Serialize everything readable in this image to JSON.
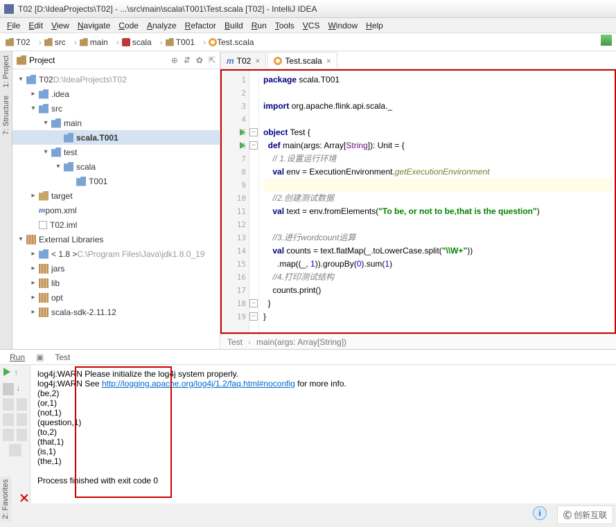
{
  "title": "T02 [D:\\IdeaProjects\\T02] - ...\\src\\main\\scala\\T001\\Test.scala [T02] - IntelliJ IDEA",
  "menu": [
    "File",
    "Edit",
    "View",
    "Navigate",
    "Code",
    "Analyze",
    "Refactor",
    "Build",
    "Run",
    "Tools",
    "VCS",
    "Window",
    "Help"
  ],
  "breadcrumbs": [
    {
      "icon": "folder",
      "text": "T02"
    },
    {
      "icon": "folder",
      "text": "src"
    },
    {
      "icon": "folder",
      "text": "main"
    },
    {
      "icon": "scala",
      "text": "scala"
    },
    {
      "icon": "folder",
      "text": "T001"
    },
    {
      "icon": "obj",
      "text": "Test.scala"
    }
  ],
  "sideTabs": {
    "project": "1: Project",
    "structure": "7: Structure",
    "favorites": "2: Favorites"
  },
  "projectPanel": {
    "title": "Project"
  },
  "tree": [
    {
      "depth": 0,
      "tw": "▾",
      "icon": "folder-blue",
      "text": "T02",
      "suffix": "D:\\IdeaProjects\\T02"
    },
    {
      "depth": 1,
      "tw": "▸",
      "icon": "folder-blue",
      "text": ".idea"
    },
    {
      "depth": 1,
      "tw": "▾",
      "icon": "folder-blue",
      "text": "src"
    },
    {
      "depth": 2,
      "tw": "▾",
      "icon": "folder-blue",
      "text": "main"
    },
    {
      "depth": 3,
      "tw": "",
      "icon": "folder-blue",
      "text": "scala.T001",
      "sel": true
    },
    {
      "depth": 2,
      "tw": "▾",
      "icon": "folder-blue",
      "text": "test"
    },
    {
      "depth": 3,
      "tw": "▾",
      "icon": "folder-blue",
      "text": "scala"
    },
    {
      "depth": 4,
      "tw": "",
      "icon": "folder-blue",
      "text": "T001"
    },
    {
      "depth": 1,
      "tw": "▸",
      "icon": "folder-tan",
      "text": "target"
    },
    {
      "depth": 1,
      "tw": "",
      "icon": "maven",
      "text": "pom.xml"
    },
    {
      "depth": 1,
      "tw": "",
      "icon": "file",
      "text": "T02.iml"
    },
    {
      "depth": 0,
      "tw": "▾",
      "icon": "lib",
      "text": "External Libraries"
    },
    {
      "depth": 1,
      "tw": "▸",
      "icon": "folder-blue",
      "text": "< 1.8 >",
      "suffix": "C:\\Program Files\\Java\\jdk1.8.0_19"
    },
    {
      "depth": 1,
      "tw": "▸",
      "icon": "lib",
      "text": "jars"
    },
    {
      "depth": 1,
      "tw": "▸",
      "icon": "lib",
      "text": "lib"
    },
    {
      "depth": 1,
      "tw": "▸",
      "icon": "lib",
      "text": "opt"
    },
    {
      "depth": 1,
      "tw": "▸",
      "icon": "lib",
      "text": "scala-sdk-2.11.12"
    }
  ],
  "editorTabs": [
    {
      "icon": "maven",
      "label": "T02",
      "active": false
    },
    {
      "icon": "obj",
      "label": "Test.scala",
      "active": true
    }
  ],
  "code": {
    "lines": [
      {
        "n": 1,
        "html": "<span class='kw'>package</span> scala.T001"
      },
      {
        "n": 2,
        "html": ""
      },
      {
        "n": 3,
        "html": "<span class='kw'>import</span> org.apache.flink.api.scala._"
      },
      {
        "n": 4,
        "html": ""
      },
      {
        "n": 5,
        "html": "<span class='kw'>object</span> Test {",
        "run": true,
        "fold": true
      },
      {
        "n": 6,
        "html": "  <span class='kw'>def</span> main(args: Array[<span class='tn'>String</span>]): Unit = {",
        "run": true,
        "fold": true
      },
      {
        "n": 7,
        "html": "    <span class='cm'>// 1.设置运行环境</span>"
      },
      {
        "n": 8,
        "html": "    <span class='kw'>val</span> env = ExecutionEnvironment.<span class='fn'>getExecutionEnvironment</span>"
      },
      {
        "n": 9,
        "html": "    ",
        "hl": true
      },
      {
        "n": 10,
        "html": "    <span class='cm'>//2.创建测试数据</span>"
      },
      {
        "n": 11,
        "html": "    <span class='kw'>val</span> text = env.fromElements(<span class='st'>\"To be, or not to be,that is the question\"</span>)"
      },
      {
        "n": 12,
        "html": ""
      },
      {
        "n": 13,
        "html": "    <span class='cm'>//3.进行<i>wordcount</i>运算</span>"
      },
      {
        "n": 14,
        "html": "    <span class='kw'>val</span> counts = text.flatMap(_.toLowerCase.split(<span class='st'>\"\\\\W+\"</span>))"
      },
      {
        "n": 15,
        "html": "      .map((_, <span class='nm'>1</span>)).groupBy(<span class='nm'>0</span>).sum(<span class='nm'>1</span>)"
      },
      {
        "n": 16,
        "html": "    <span class='cm'>//4.打印测试结构</span>"
      },
      {
        "n": 17,
        "html": "    counts.print()"
      },
      {
        "n": 18,
        "html": "  }",
        "fold": true
      },
      {
        "n": 19,
        "html": "}",
        "fold": true
      }
    ]
  },
  "editorBreadcrumb": {
    "a": "Test",
    "b": "main(args: Array[String])"
  },
  "runTabs": {
    "run": "Run",
    "test": "Test"
  },
  "console": {
    "l1a": "log4j:WARN Please initialize the log4j system properly.",
    "l2a": "log4j:WARN See ",
    "l2link": "http://logging.apache.org/log4j/1.2/faq.html#noconfig",
    "l2b": " for more info.",
    "rows": [
      "(be,2)",
      "(or,1)",
      "(not,1)",
      "(question,1)",
      "(to,2)",
      "(that,1)",
      "(is,1)",
      "(the,1)"
    ],
    "exit": "Process finished with exit code 0"
  },
  "corner": "创新互联"
}
